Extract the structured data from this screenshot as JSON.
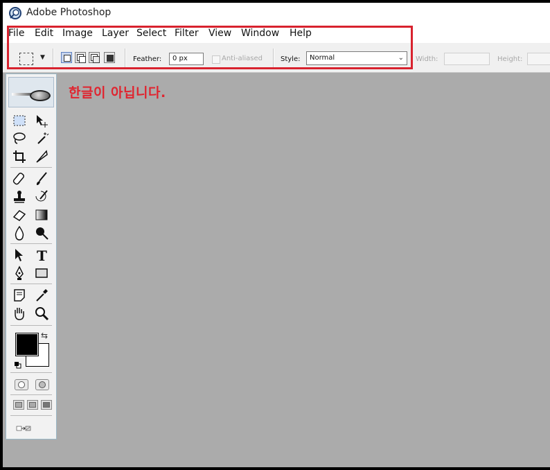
{
  "app": {
    "title": "Adobe Photoshop",
    "icon": "photoshop-logo-icon"
  },
  "menu": {
    "items": [
      "File",
      "Edit",
      "Image",
      "Layer",
      "Select",
      "Filter",
      "View",
      "Window",
      "Help"
    ]
  },
  "options": {
    "feather_label": "Feather:",
    "feather_value": "0 px",
    "antialiased_label": "Anti-aliased",
    "style_label": "Style:",
    "style_value": "Normal",
    "width_label": "Width:",
    "height_label": "Height:"
  },
  "annotation": {
    "text": "한글이 아닙니다.",
    "color": "#e0242f"
  },
  "colors": {
    "highlight_box": "#d8222e",
    "canvas": "#ababab",
    "foreground_color": "#000000",
    "background_color": "#ffffff"
  },
  "tools": [
    "rectangular-marquee-icon",
    "move-icon",
    "lasso-icon",
    "magic-wand-icon",
    "crop-icon",
    "slice-icon",
    "healing-brush-icon",
    "brush-icon",
    "clone-stamp-icon",
    "history-brush-icon",
    "eraser-icon",
    "gradient-icon",
    "blur-icon",
    "dodge-icon",
    "path-selection-icon",
    "type-icon",
    "pen-icon",
    "rectangle-shape-icon",
    "notes-icon",
    "eyedropper-icon",
    "hand-icon",
    "zoom-icon"
  ]
}
